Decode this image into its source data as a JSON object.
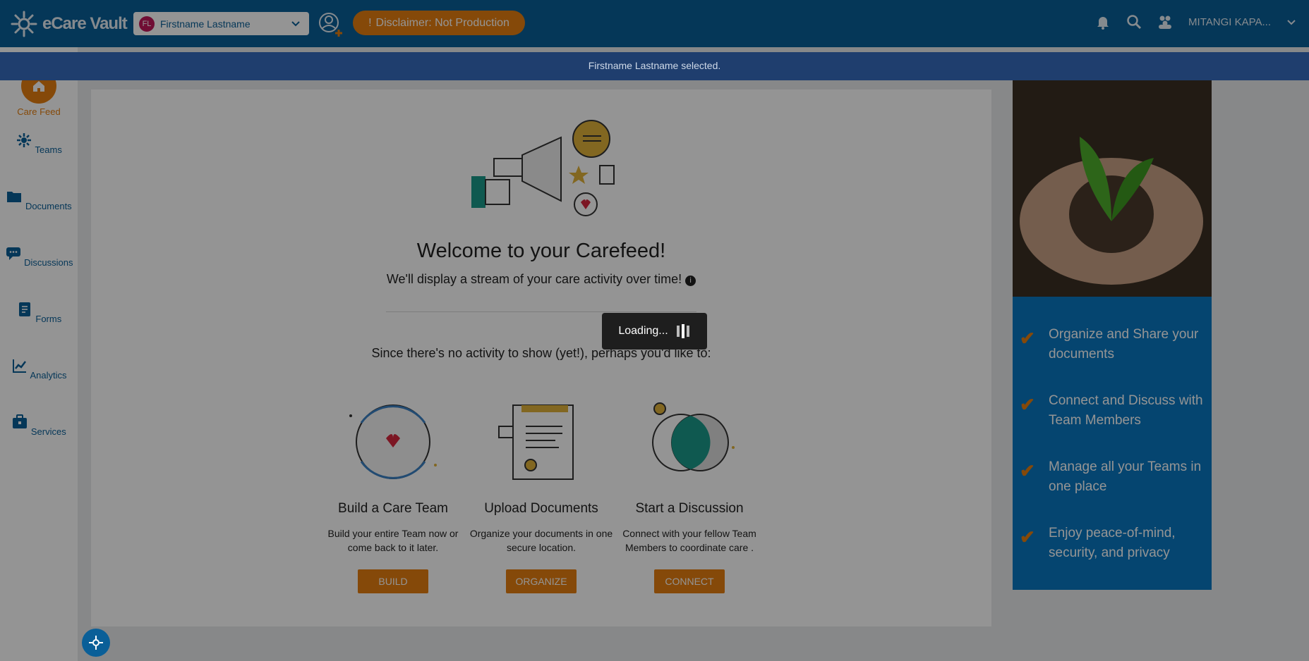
{
  "header": {
    "logo_text": "eCare Vault",
    "patient": {
      "initials": "FL",
      "name": "Firstname Lastname"
    },
    "disclaimer": "Disclaimer: Not Production",
    "user_name": "MITANGI KAPA...",
    "icons": [
      "logo-icon",
      "chevron-down-icon",
      "add-user-icon",
      "bell-icon",
      "search-icon",
      "people-icon",
      "chevron-down-icon"
    ]
  },
  "toast": {
    "message": "Firstname Lastname selected."
  },
  "sidebar": {
    "items": [
      {
        "label": "Care Feed",
        "icon": "home-icon",
        "active": true
      },
      {
        "label": "Teams",
        "icon": "team-icon"
      },
      {
        "label": "Documents",
        "icon": "folder-icon"
      },
      {
        "label": "Discussions",
        "icon": "chat-icon"
      },
      {
        "label": "Forms",
        "icon": "form-icon"
      },
      {
        "label": "Analytics",
        "icon": "chart-icon"
      },
      {
        "label": "Services",
        "icon": "briefcase-icon"
      }
    ]
  },
  "main": {
    "welcome_title": "Welcome to your Carefeed!",
    "welcome_subtitle": "We'll display a stream of your care activity over time!",
    "since_text": "Since there's no activity to show (yet!), perhaps you'd like to:",
    "actions": [
      {
        "title": "Build a Care Team",
        "desc": "Build your entire Team now or come back to it later.",
        "button": "BUILD"
      },
      {
        "title": "Upload Documents",
        "desc": "Organize your documents in one secure location.",
        "button": "ORGANIZE"
      },
      {
        "title": "Start a Discussion",
        "desc": "Connect with your fellow Team Members to coordinate care .",
        "button": "CONNECT"
      }
    ]
  },
  "benefits": [
    "Organize and Share your documents",
    "Connect and Discuss with Team Members",
    "Manage all your Teams in one place",
    "Enjoy peace-of-mind, security, and privacy"
  ],
  "loading": {
    "text": "Loading..."
  },
  "colors": {
    "brand_blue": "#0a5f98",
    "accent_orange": "#e57f10",
    "panel_blue": "#0a78c2",
    "toast_bg": "#1f3e6e"
  }
}
